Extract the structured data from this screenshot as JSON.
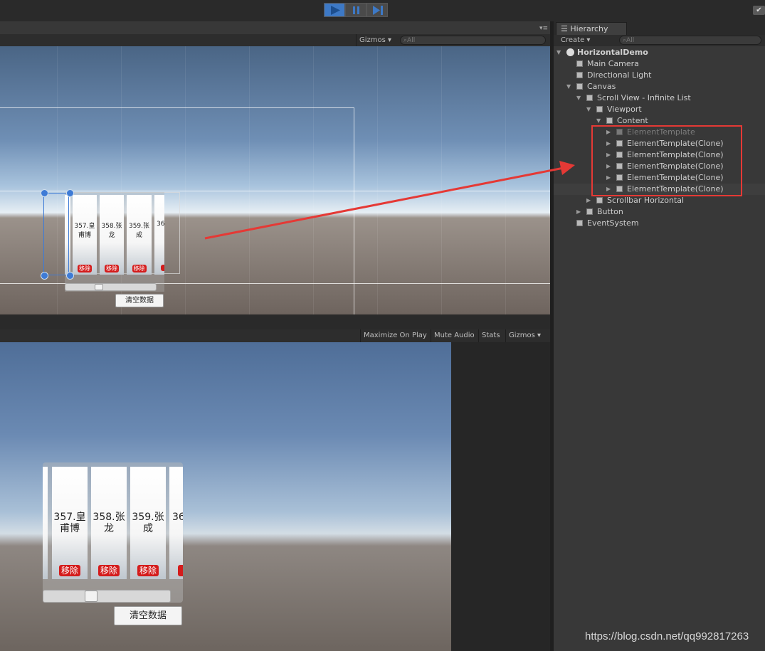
{
  "toolbar": {
    "play_icon": "play-icon",
    "pause_icon": "pause-icon",
    "step_icon": "step-icon",
    "toggle_icon": "checkmark-icon"
  },
  "scene": {
    "gizmos": "Gizmos",
    "search_placeholder": "All"
  },
  "game": {
    "maximize": "Maximize On Play",
    "mute": "Mute Audio",
    "stats": "Stats",
    "gizmos": "Gizmos"
  },
  "hierarchy": {
    "tab": "Hierarchy",
    "create": "Create",
    "search_placeholder": "All",
    "scene_name": "HorizontalDemo",
    "items": [
      {
        "label": "Main Camera"
      },
      {
        "label": "Directional Light"
      },
      {
        "label": "Canvas"
      },
      {
        "label": "Scroll View - Infinite List"
      },
      {
        "label": "Viewport"
      },
      {
        "label": "Content"
      },
      {
        "label": "ElementTemplate"
      },
      {
        "label": "ElementTemplate(Clone)"
      },
      {
        "label": "ElementTemplate(Clone)"
      },
      {
        "label": "ElementTemplate(Clone)"
      },
      {
        "label": "ElementTemplate(Clone)"
      },
      {
        "label": "ElementTemplate(Clone)"
      },
      {
        "label": "Scrollbar Horizontal"
      },
      {
        "label": "Button"
      },
      {
        "label": "EventSystem"
      }
    ]
  },
  "list": {
    "cards": [
      {
        "line1": "357.皇",
        "line2": "甫博"
      },
      {
        "line1": "358.张",
        "line2": "龙"
      },
      {
        "line1": "359.张",
        "line2": "成"
      },
      {
        "line1": "36",
        "line2": ""
      }
    ],
    "remove_label": "移除",
    "clear_button": "清空数据",
    "scroll_position": 0.36
  },
  "watermark": "https://blog.csdn.net/qq992817263",
  "colors": {
    "accent_red": "#e53935",
    "remove_red": "#d41c1c",
    "play_blue": "#3d79c6"
  }
}
